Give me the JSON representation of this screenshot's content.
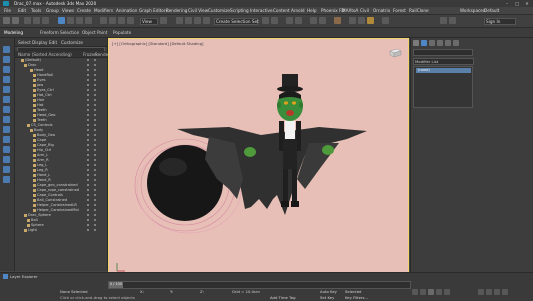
{
  "window": {
    "title": "Drac_07.max - Autodesk 3ds Max 2020"
  },
  "menu": [
    "File",
    "Edit",
    "Tools",
    "Group",
    "Views",
    "Create",
    "Modifiers",
    "Animation",
    "Graph Editors",
    "Rendering",
    "Civil View",
    "Customize",
    "Scripting",
    "Interactive",
    "Content",
    "Arnold",
    "Help",
    "Phoenix FD",
    "MAXtoA",
    "Civil",
    "Ornatrix",
    "Forest",
    "RailClone"
  ],
  "toolbar": {
    "selection_set": "Create Selection Set",
    "view_ref": "View",
    "workspace_label": "Workspaces:",
    "workspace_value": "Default",
    "user_label": "Sign In"
  },
  "ribbon": {
    "tabs": [
      "Modeling",
      "Freeform",
      "Selection",
      "Object Paint",
      "Populate"
    ]
  },
  "explorer": {
    "tabs": [
      "Select",
      "Display",
      "Edit",
      "Customize"
    ],
    "columns": [
      "Name (Sorted Ascending)",
      "Frozen",
      "Render"
    ],
    "rows": [
      {
        "label": "(Default)",
        "indent": 2
      },
      {
        "label": "Drac",
        "indent": 3
      },
      {
        "label": "Head",
        "indent": 5
      },
      {
        "label": "HandRoll",
        "indent": 6
      },
      {
        "label": "Eyes",
        "indent": 6
      },
      {
        "label": "Jaw",
        "indent": 6
      },
      {
        "label": "Eyes_Ctrl",
        "indent": 6
      },
      {
        "label": "Hat_Ctrl",
        "indent": 6
      },
      {
        "label": "Hair",
        "indent": 6
      },
      {
        "label": "Hat",
        "indent": 6
      },
      {
        "label": "Teeth",
        "indent": 6
      },
      {
        "label": "Head_Geo",
        "indent": 6
      },
      {
        "label": "Teeth",
        "indent": 6
      },
      {
        "label": "CS_Controls",
        "indent": 4
      },
      {
        "label": "Body",
        "indent": 5
      },
      {
        "label": "Body_Geo",
        "indent": 6
      },
      {
        "label": "Cape",
        "indent": 6
      },
      {
        "label": "Cape_Rig",
        "indent": 6
      },
      {
        "label": "Hip_Ctrl",
        "indent": 6
      },
      {
        "label": "Arm_L",
        "indent": 6
      },
      {
        "label": "Arm_R",
        "indent": 6
      },
      {
        "label": "Leg_L",
        "indent": 6
      },
      {
        "label": "Leg_R",
        "indent": 6
      },
      {
        "label": "Hand_L",
        "indent": 6
      },
      {
        "label": "Hand_R",
        "indent": 6
      },
      {
        "label": "Cape_geo_constrained",
        "indent": 6
      },
      {
        "label": "Cape_rope_constrained",
        "indent": 6
      },
      {
        "label": "Cape_Controls",
        "indent": 6
      },
      {
        "label": "Ball_Constrained",
        "indent": 6
      },
      {
        "label": "Helper_ConstrainedLR",
        "indent": 6
      },
      {
        "label": "Helper_ConstrainedMid",
        "indent": 6
      },
      {
        "label": "Drac_Sphere",
        "indent": 3
      },
      {
        "label": "Ball",
        "indent": 4
      },
      {
        "label": "Sphere",
        "indent": 4
      },
      {
        "label": "Light",
        "indent": 3
      }
    ]
  },
  "viewport": {
    "label": "[+] [Orthographic] [Standard] [Default Shading]"
  },
  "command_panel": {
    "field": "Modifier List",
    "selected_item": "(none)"
  },
  "status": {
    "layer_label": "Layer Explorer",
    "selection": "None Selected",
    "frame": "0 / 100",
    "add_time_tag": "Add Time Tag",
    "set_key": "Set Key",
    "auto_key": "Auto Key",
    "selected": "Selected",
    "key_filters": "Key Filters...",
    "x_label": "X:",
    "y_label": "Y:",
    "z_label": "Z:",
    "grid": "Grid = 10.0cm",
    "prompt": "Click or click-and-drag to select objects"
  }
}
